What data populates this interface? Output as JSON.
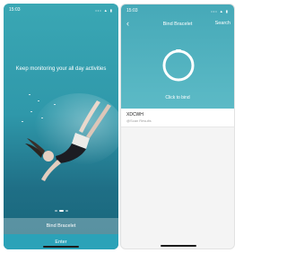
{
  "left": {
    "status": {
      "time": "15:03",
      "icons": "••• ▲ ▮"
    },
    "slogan": "Keep monitoring your all day activities",
    "bind_button": "Bind Bracelet",
    "enter_button": "Enter",
    "pager": {
      "count": 3,
      "active": 1
    }
  },
  "right": {
    "status": {
      "time": "15:03",
      "icons": "••• ▲ ▮"
    },
    "nav": {
      "back": "‹",
      "title": "Bind Bracelet",
      "search": "Search"
    },
    "click_to_bind": "Click to bind",
    "device": {
      "name": "XDCWH",
      "subtitle": "@Scan Results"
    }
  },
  "colors": {
    "accent": "#46a9b8",
    "enter": "#2ba2b8"
  }
}
